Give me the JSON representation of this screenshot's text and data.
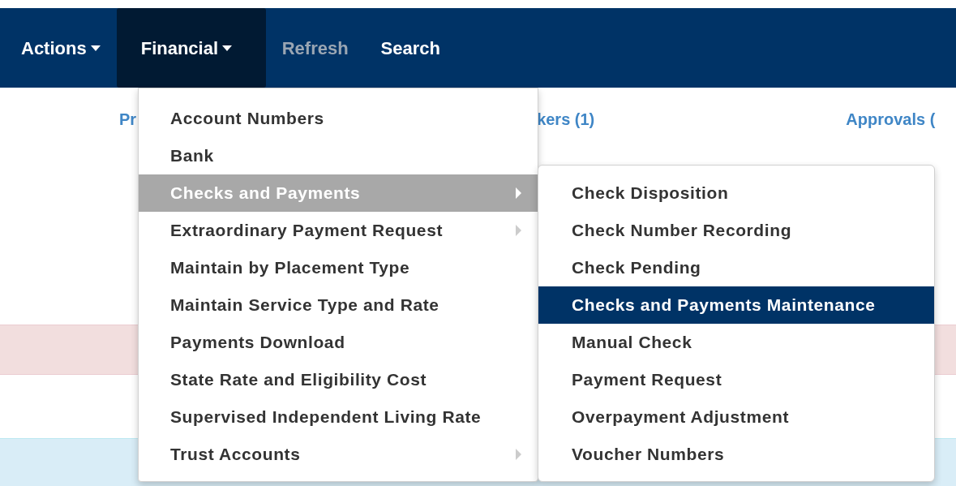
{
  "navbar": {
    "items": [
      {
        "label": "Actions",
        "dropdown": true,
        "active": false,
        "disabled": false
      },
      {
        "label": "Financial",
        "dropdown": true,
        "active": true,
        "disabled": false
      },
      {
        "label": "Refresh",
        "dropdown": false,
        "active": false,
        "disabled": true
      },
      {
        "label": "Search",
        "dropdown": false,
        "active": false,
        "disabled": false
      }
    ]
  },
  "page_links": [
    "Pr",
    "kers (1)",
    "Approvals ("
  ],
  "financial_menu": {
    "items": [
      {
        "label": "Account Numbers",
        "submenu": false,
        "selected": false
      },
      {
        "label": "Bank",
        "submenu": false,
        "selected": false
      },
      {
        "label": "Checks and Payments",
        "submenu": true,
        "selected": true
      },
      {
        "label": "Extraordinary Payment Request",
        "submenu": true,
        "selected": false
      },
      {
        "label": "Maintain by Placement Type",
        "submenu": false,
        "selected": false
      },
      {
        "label": "Maintain Service Type and Rate",
        "submenu": false,
        "selected": false
      },
      {
        "label": "Payments Download",
        "submenu": false,
        "selected": false
      },
      {
        "label": "State Rate and Eligibility Cost",
        "submenu": false,
        "selected": false
      },
      {
        "label": "Supervised Independent Living Rate",
        "submenu": false,
        "selected": false
      },
      {
        "label": "Trust Accounts",
        "submenu": true,
        "selected": false
      }
    ]
  },
  "checks_submenu": {
    "items": [
      {
        "label": "Check Disposition",
        "selected": false
      },
      {
        "label": "Check Number Recording",
        "selected": false
      },
      {
        "label": "Check Pending",
        "selected": false
      },
      {
        "label": "Checks and Payments Maintenance",
        "selected": true
      },
      {
        "label": "Manual Check",
        "selected": false
      },
      {
        "label": "Payment Request",
        "selected": false
      },
      {
        "label": "Overpayment Adjustment",
        "selected": false
      },
      {
        "label": "Voucher Numbers",
        "selected": false
      }
    ]
  }
}
